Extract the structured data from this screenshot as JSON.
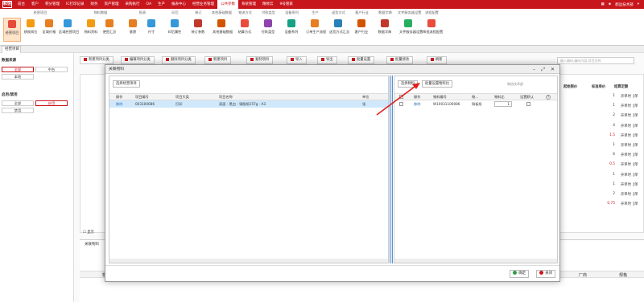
{
  "app": {
    "logo": "和信",
    "nav": [
      "前台",
      "客户",
      "积分管理",
      "IC打印记录",
      "财务",
      "资产管理",
      "采购执行",
      "OA",
      "生产",
      "报表中心",
      "经营业务管理",
      "公共参数",
      "系统管理",
      "精修云",
      "9号管家"
    ],
    "active_nav": "公共参数",
    "user": "鹤远技术部",
    "accent": "#c8161d"
  },
  "ribbon": {
    "groups": [
      {
        "title": "经营项目",
        "buttons": [
          "经营项目",
          "绩效岗位",
          "区域价格",
          "区域经营项目"
        ]
      },
      {
        "title": "物料数据",
        "buttons": [
          "物料资料",
          "便签汇总"
        ]
      },
      {
        "title": "报表",
        "buttons": [
          "意愿",
          "尺寸"
        ]
      },
      {
        "title": "印后",
        "buttons": [
          "印后属性"
        ]
      },
      {
        "title": "装订",
        "buttons": [
          "装订参数"
        ]
      },
      {
        "title": "其他基础数据",
        "buttons": [
          "其他基础数据"
        ]
      },
      {
        "title": "物流方式",
        "buttons": [
          "结算方式"
        ]
      },
      {
        "title": "付款类型",
        "buttons": [
          "付款类型"
        ]
      },
      {
        "title": "设备系列",
        "buttons": [
          "设备系列"
        ]
      },
      {
        "title": "生产",
        "buttons": [
          "订单生产流程"
        ]
      },
      {
        "title": "送货方式",
        "buttons": [
          "送货方式汇总"
        ]
      },
      {
        "title": "客户行业",
        "buttons": [
          "客户行业"
        ]
      },
      {
        "title": "数据字典",
        "buttons": [
          "数据字典"
        ]
      },
      {
        "title": "文件服务器设置",
        "buttons": [
          "文件服务器设置"
        ]
      },
      {
        "title": "流程配置",
        "buttons": [
          "审批流程配置"
        ]
      }
    ]
  },
  "tabs": {
    "active": "经营项目"
  },
  "left": {
    "h1": "数据来源",
    "b1": [
      "全部",
      "中台",
      "本地"
    ],
    "h2": "启用/禁用",
    "b2": [
      "全部",
      "启用",
      "禁用"
    ]
  },
  "toolbar": {
    "buttons": [
      "新建项目分类",
      "编辑项目分类",
      "删除项目分类",
      "新建项目",
      "复制项目",
      "导入",
      "导出",
      "批量设置",
      "批量修改",
      "刷新"
    ],
    "search_placeholder": "输入编码,编码内容,项目名称",
    "left_label": "经营项目分"
  },
  "grid": {
    "right_headers": [
      "起始限价",
      "标准单价",
      "结算定额"
    ],
    "std_prices": [
      "1",
      "1",
      "2",
      "4",
      "1.5",
      "1",
      "6",
      "0.5",
      "1",
      "1",
      "2",
      "0.75"
    ],
    "settle": [
      "开单时【单",
      "开单时【单",
      "开单时【单",
      "开单时【单",
      "开单时【单",
      "开单时【单",
      "开单时【单",
      "开单时【单",
      "开单时【单",
      "开单时【单",
      "开单时【单",
      "开单时【单"
    ],
    "show_label": "显示",
    "bottom_title": "关联物料",
    "bottom_cols": [
      "物",
      "",
      "厂商",
      "规格"
    ]
  },
  "modal": {
    "title": "关联物料",
    "left": {
      "button": "选择经营项目",
      "headers": [
        "操作",
        "项目编号",
        "项目大类",
        "项目名称",
        "单位"
      ],
      "row": [
        "移除",
        "003100086",
        "打印",
        "双面 - 黑白 - 铜版纸157g - A3",
        "张"
      ]
    },
    "right": {
      "buttons": [
        "选择物料",
        "批量设置物料比"
      ],
      "search_value": "和信技术部",
      "headers": [
        "操作",
        "物料编号",
        "物...",
        "物料比",
        "设置默认"
      ],
      "row": [
        "移除",
        "W10031100086",
        "铜板纸",
        "1"
      ]
    },
    "footer": {
      "ok": "确定",
      "close": "关闭"
    }
  }
}
